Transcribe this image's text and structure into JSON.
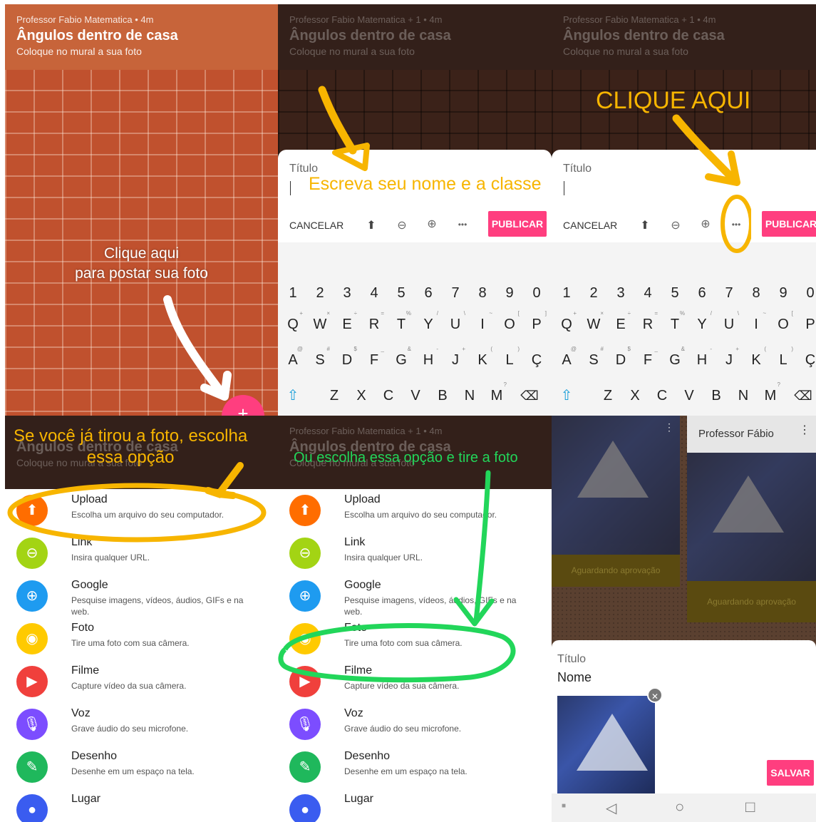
{
  "pad": {
    "author": "Professor Fabio Matematica",
    "author_time": "• 4m",
    "author_plus": "+ 1 • 4m",
    "title": "Ângulos dentro de casa",
    "subtitle": "Coloque no mural a sua foto"
  },
  "panel1": {
    "annotation_line1": "Clique aqui",
    "annotation_line2": "para postar sua foto",
    "fab_label": "+"
  },
  "post_form": {
    "title_label": "Título",
    "cancel_label": "CANCELAR",
    "publish_label": "PUBLICAR",
    "more_label": "•••"
  },
  "panel2": {
    "annotation": "Escreva seu nome e a classe"
  },
  "panel3": {
    "annotation": "CLIQUE AQUI"
  },
  "keyboard": {
    "row1": [
      "1",
      "2",
      "3",
      "4",
      "5",
      "6",
      "7",
      "8",
      "9",
      "0"
    ],
    "row2": [
      "Q",
      "W",
      "E",
      "R",
      "T",
      "Y",
      "U",
      "I",
      "O",
      "P"
    ],
    "row2_hints": [
      "+",
      "×",
      "÷",
      "=",
      "%",
      "/",
      "\\",
      "~",
      "[",
      "]"
    ],
    "row3": [
      "A",
      "S",
      "D",
      "F",
      "G",
      "H",
      "J",
      "K",
      "L",
      "Ç"
    ],
    "row3_hints": [
      "@",
      "#",
      "$",
      "_",
      "&",
      "-",
      "+",
      "(",
      ")",
      ""
    ],
    "row4": [
      "Z",
      "X",
      "C",
      "V",
      "B",
      "N",
      "M"
    ],
    "row4_hints": [
      "",
      "",
      "",
      "",
      "",
      "",
      "?"
    ]
  },
  "panel4": {
    "annotation_line1": "Se você já tirou a foto, escolha",
    "annotation_line2": "essa opção"
  },
  "panel5": {
    "annotation": "Ou escolha essa opção e tire a foto"
  },
  "menu": [
    {
      "title": "Upload",
      "desc": "Escolha um arquivo do seu computador.",
      "color": "#ff6d00",
      "icon": "upload-icon",
      "glyph": "⬆"
    },
    {
      "title": "Link",
      "desc": "Insira qualquer URL.",
      "color": "#a3d414",
      "icon": "link-icon",
      "glyph": "⊖"
    },
    {
      "title": "Google",
      "desc": "Pesquise imagens, vídeos, áudios, GIFs e na web.",
      "color": "#1e9bf0",
      "icon": "google-search-icon",
      "glyph": "⊕"
    },
    {
      "title": "Foto",
      "desc": "Tire uma foto com sua câmera.",
      "color": "#ffca00",
      "icon": "camera-icon",
      "glyph": "◉"
    },
    {
      "title": "Filme",
      "desc": "Capture vídeo da sua câmera.",
      "color": "#f0403c",
      "icon": "video-camera-icon",
      "glyph": "▶"
    },
    {
      "title": "Voz",
      "desc": "Grave áudio do seu microfone.",
      "color": "#7c4dff",
      "icon": "microphone-icon",
      "glyph": "🎙"
    },
    {
      "title": "Desenho",
      "desc": "Desenhe em um espaço na tela.",
      "color": "#1fb85c",
      "icon": "draw-icon",
      "glyph": "✎"
    },
    {
      "title": "Lugar",
      "desc": "",
      "color": "#3a5cf0",
      "icon": "location-icon",
      "glyph": "●"
    }
  ],
  "panel6": {
    "card_author": "Professor Fábio",
    "pending1": "Aguardando aprovação",
    "pending2": "Aguardando aprovação",
    "form_title_label": "Título",
    "form_title_value": "Nome",
    "save_label": "SALVAR",
    "remove_label": "✕"
  },
  "colors": {
    "accent_pink": "#ff3e7f",
    "annotation_yellow": "#f7b500",
    "annotation_green": "#22d65a"
  }
}
